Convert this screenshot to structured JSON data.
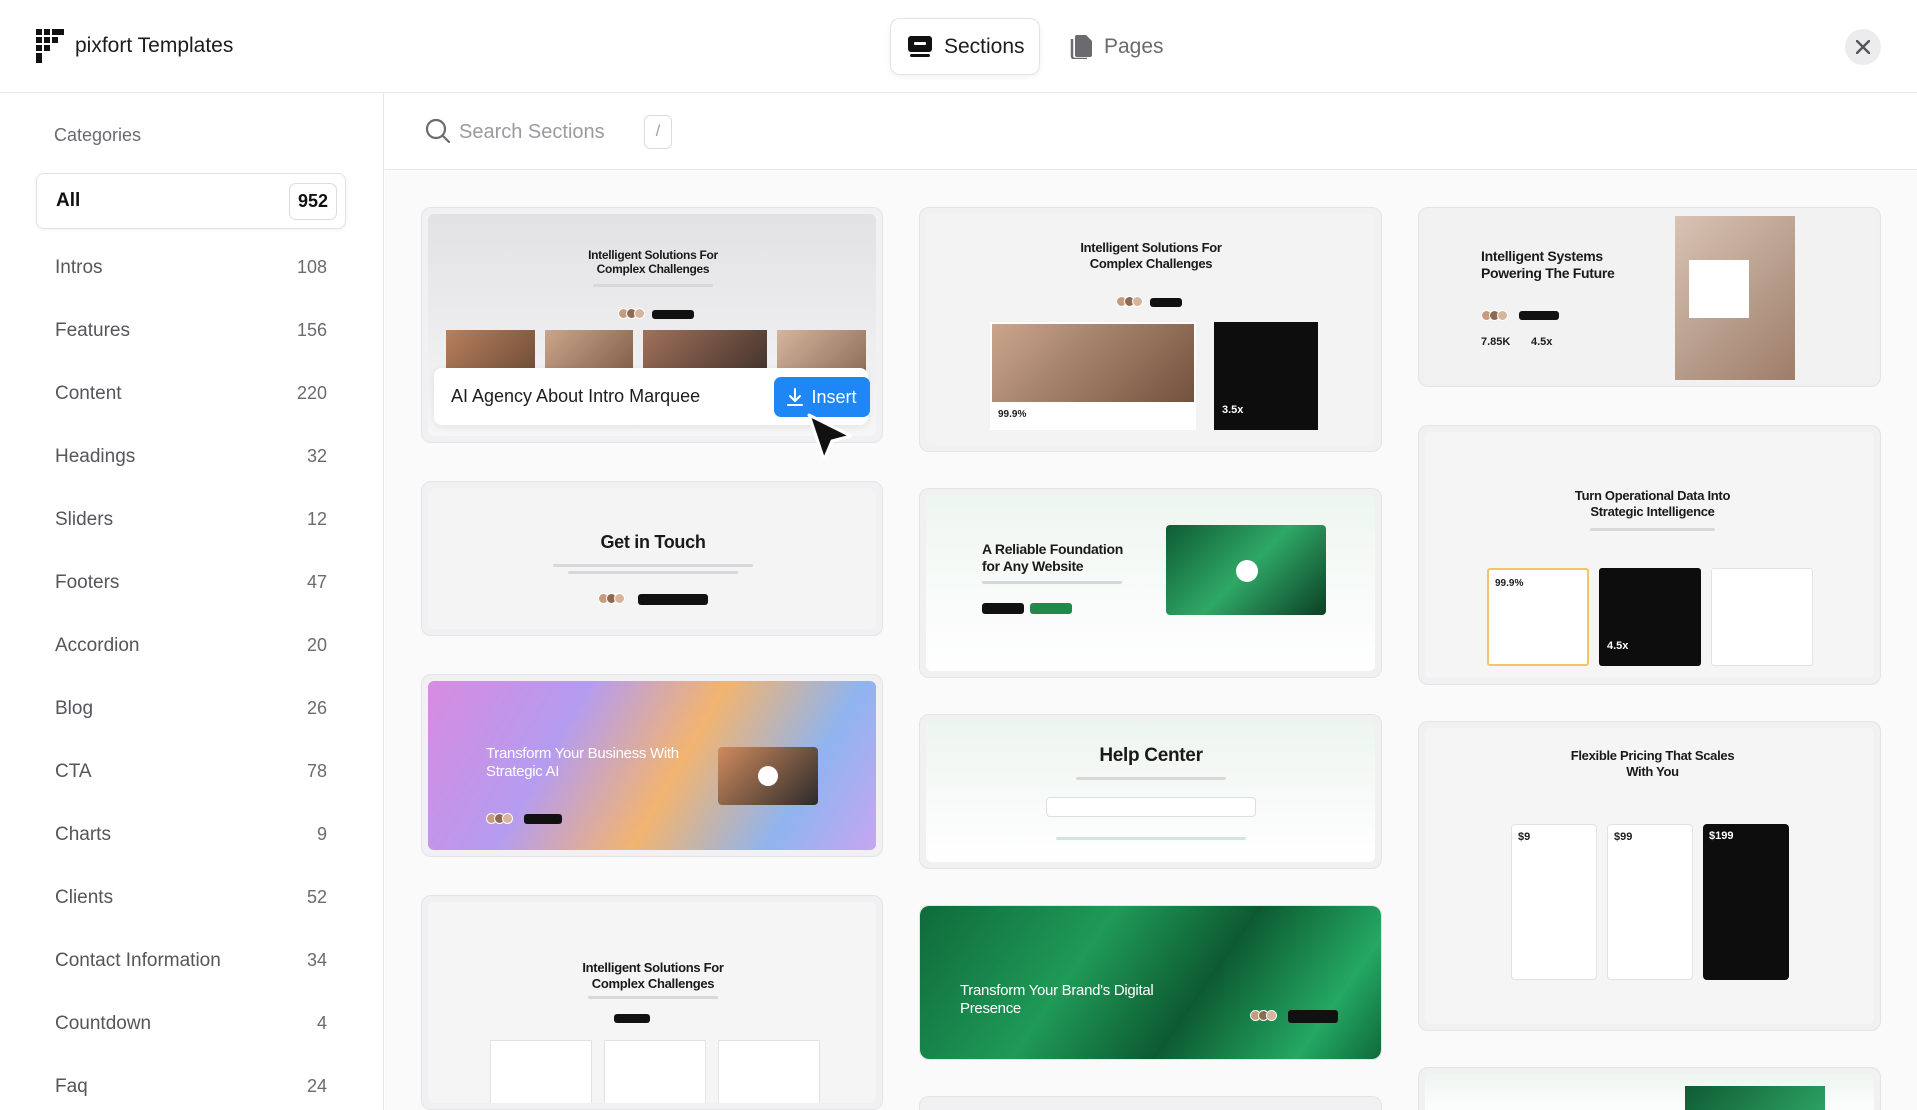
{
  "header": {
    "brand": "pixfort Templates",
    "tabs": [
      {
        "label": "Sections",
        "active": true
      },
      {
        "label": "Pages",
        "active": false
      }
    ]
  },
  "sidebar": {
    "title": "Categories",
    "items": [
      {
        "label": "All",
        "count": "952",
        "active": true
      },
      {
        "label": "Intros",
        "count": "108"
      },
      {
        "label": "Features",
        "count": "156"
      },
      {
        "label": "Content",
        "count": "220"
      },
      {
        "label": "Headings",
        "count": "32"
      },
      {
        "label": "Sliders",
        "count": "12"
      },
      {
        "label": "Footers",
        "count": "47"
      },
      {
        "label": "Accordion",
        "count": "20"
      },
      {
        "label": "Blog",
        "count": "26"
      },
      {
        "label": "CTA",
        "count": "78"
      },
      {
        "label": "Charts",
        "count": "9"
      },
      {
        "label": "Clients",
        "count": "52"
      },
      {
        "label": "Contact Information",
        "count": "34"
      },
      {
        "label": "Countdown",
        "count": "4"
      },
      {
        "label": "Faq",
        "count": "24"
      }
    ]
  },
  "search": {
    "placeholder": "Search Sections",
    "shortcut": "/"
  },
  "cards": {
    "c1": {
      "title": "Intelligent Solutions For Complex Challenges",
      "hover_label": "AI Agency About Intro Marquee",
      "insert_label": "Insert"
    },
    "c2": {
      "title": "Get in Touch"
    },
    "c3": {
      "title": "Transform Your Business With Strategic AI"
    },
    "c4": {
      "title": "Intelligent Solutions For Complex Challenges"
    },
    "c5": {
      "title": "Intelligent Solutions For Complex Challenges",
      "stat1": "99.9%",
      "stat2": "3.5x"
    },
    "c6": {
      "title": "A Reliable Foundation for Any Website"
    },
    "c7": {
      "title": "Help Center"
    },
    "c8": {
      "title": "Transform Your Brand's Digital Presence"
    },
    "c9": {
      "title": "Intelligent Systems Powering The Future",
      "stat1": "7.85K",
      "stat2": "4.5x"
    },
    "c10": {
      "title": "Turn Operational Data Into Strategic Intelligence",
      "stat1": "99.9%",
      "stat2": "4.5x"
    },
    "c11": {
      "title": "Flexible Pricing That Scales With You",
      "price1": "$9",
      "price2": "$99",
      "price3": "$199"
    }
  },
  "colors": {
    "accent": "#1e86f5",
    "green": "#1f8a4c",
    "dark": "#111111"
  }
}
